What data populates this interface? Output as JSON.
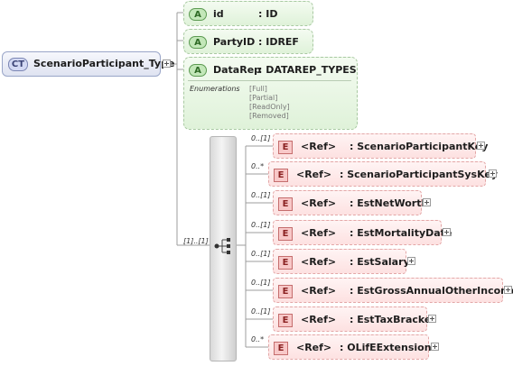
{
  "complex_type": {
    "badge": "CT",
    "name": "ScenarioParticipant_Type"
  },
  "attributes": [
    {
      "badge": "A",
      "name": "id",
      "type": ": ID"
    },
    {
      "badge": "A",
      "name": "PartyID",
      "type": ": IDREF"
    },
    {
      "badge": "A",
      "name": "DataRep",
      "type": ": DATAREP_TYPES",
      "enumerations_label": "Enumerations",
      "enumerations": [
        "[Full]",
        "[Partial]",
        "[ReadOnly]",
        "[Removed]"
      ]
    }
  ],
  "sequence": {
    "cardinality": "[1]..[1]"
  },
  "elements": [
    {
      "badge": "E",
      "ref": "<Ref>",
      "name": ": ScenarioParticipantKey",
      "cardinality": "0..[1]"
    },
    {
      "badge": "E",
      "ref": "<Ref>",
      "name": ": ScenarioParticipantSysKey",
      "cardinality": "0..*"
    },
    {
      "badge": "E",
      "ref": "<Ref>",
      "name": ": EstNetWorth",
      "cardinality": "0..[1]"
    },
    {
      "badge": "E",
      "ref": "<Ref>",
      "name": ": EstMortalityDate",
      "cardinality": "0..[1]"
    },
    {
      "badge": "E",
      "ref": "<Ref>",
      "name": ": EstSalary",
      "cardinality": "0..[1]"
    },
    {
      "badge": "E",
      "ref": "<Ref>",
      "name": ": EstGrossAnnualOtherIncome",
      "cardinality": "0..[1]"
    },
    {
      "badge": "E",
      "ref": "<Ref>",
      "name": ": EstTaxBracket",
      "cardinality": "0..[1]"
    },
    {
      "badge": "E",
      "ref": "<Ref>",
      "name": ": OLifEExtension",
      "cardinality": "0..*"
    }
  ]
}
